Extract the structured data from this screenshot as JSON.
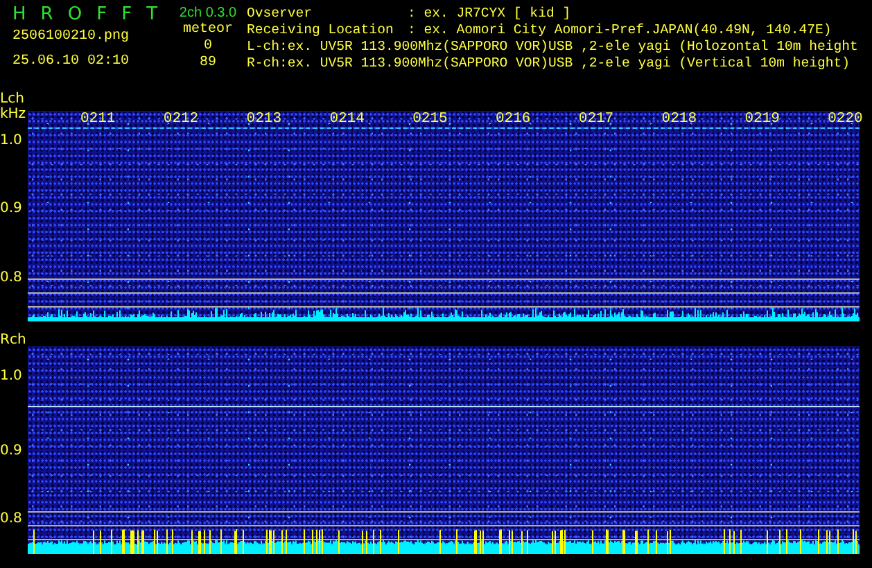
{
  "app": {
    "logo": "H R O F F T",
    "version": "2ch 0.3.0",
    "filename": "2506100210.png",
    "datetime": "25.06.10 02:10"
  },
  "meteor": {
    "label": "meteor",
    "counts": [
      "0",
      "89"
    ]
  },
  "info": [
    {
      "label": "Ovserver",
      "value": ": ex. JR7CYX [ kid ]"
    },
    {
      "label": "Receiving Location",
      "value": ": ex. Aomori City Aomori-Pref.JAPAN(40.49N, 140.47E)"
    }
  ],
  "channel_lines": [
    "L-ch:ex. UV5R 113.900Mhz(SAPPORO VOR)USB ,2-ele yagi (Holozontal 10m height",
    "R-ch:ex. UV5R 113.900Mhz(SAPPORO VOR)USB ,2-ele yagi (Vertical 10m height)"
  ],
  "panels": [
    {
      "name": "Lch",
      "unit": "kHz",
      "time_labels": [
        "0211",
        "0212",
        "0213",
        "0214",
        "0215",
        "0216",
        "0217",
        "0218",
        "0219",
        "0220"
      ],
      "freq_labels": [
        "1.0",
        "0.9",
        "0.8"
      ],
      "detections": false
    },
    {
      "name": "Rch",
      "freq_labels": [
        "1.0",
        "0.9",
        "0.8"
      ],
      "detections": true
    }
  ]
}
